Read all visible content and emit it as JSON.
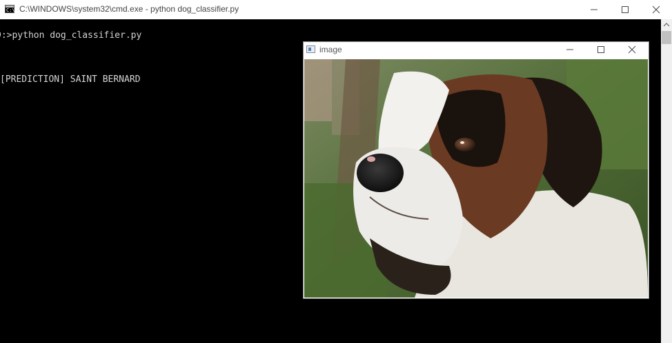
{
  "cmd_window": {
    "title": "C:\\WINDOWS\\system32\\cmd.exe - python  dog_classifier.py",
    "icon": "cmd-icon",
    "icon_glyph": "C:\\"
  },
  "console": {
    "lines": [
      "D:>python dog_classifier.py",
      "[PREDICTION] SAINT BERNARD"
    ]
  },
  "image_window": {
    "title": "image",
    "image_description": "Saint Bernard dog portrait"
  },
  "colors": {
    "console_background": "#000000",
    "console_text": "#d4d4d4",
    "titlebar": "#ffffff"
  }
}
